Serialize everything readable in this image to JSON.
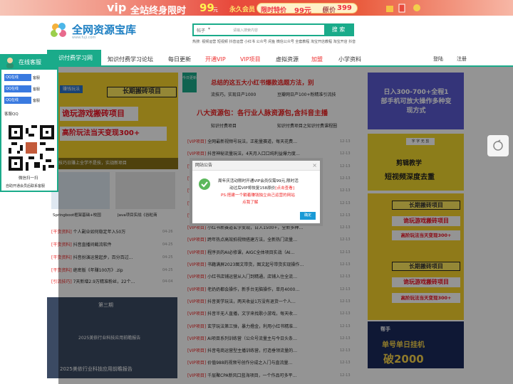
{
  "banner": {
    "vip": "vip",
    "text": "全站终身限时",
    "price_big": "99",
    "yuan": "元",
    "perm": "永久会员",
    "limited": "限时特价",
    "price": "99元",
    "orig_label": "原价",
    "orig": "399"
  },
  "header": {
    "logo_title": "全网资源宝库",
    "logo_sub": "www.fuji.com",
    "search_select": "帖子",
    "search_placeholder": "请输入搜索内容",
    "search_button": "搜 索",
    "hot": "热搜: 视频运营 短视频 抖音运营 小红书 公众号 闲鱼 微信公众号 全套教程 淘宝开店教程 淘宝开店 抖音"
  },
  "nav": {
    "items": [
      "知识付费学习网",
      "知识付费学习论坛",
      "每日更新",
      "开通VIP",
      "VIP项目",
      "虚拟资源",
      "加盟",
      "小学资料"
    ],
    "login": "登陆",
    "register": "注册"
  },
  "float_panel": {
    "title": "在线客服",
    "qq_label": "QQ在线",
    "kefu": "客服",
    "kefu_qq": "客服QQ",
    "wechat": "微信扫一扫",
    "note": "自助开通会员后联系客服"
  },
  "left_col": {
    "slide_tag": "赚钱玩法",
    "slide_title1": "长期搬砖项目",
    "slide_title2": "诡玩游戏搬砖项目",
    "slide_title3": "高阶玩法当天变现300+",
    "slide_caption": "小技巧日赚上全学不是技，实战新项目",
    "thumbs": [
      "Springboot框架基础+校园",
      "Java项目实战《谷粒商"
    ],
    "list": [
      {
        "tag": "[干货资料]",
        "text": "个人副业如何稳定年入50万",
        "date": "04-26"
      },
      {
        "tag": "[干货资料]",
        "text": "抖音直播间截流软件",
        "date": "04-25"
      },
      {
        "tag": "[干货资料]",
        "text": "抖音扮演运营起步，百分百过…",
        "date": "04-25"
      },
      {
        "tag": "[干货资料]",
        "text": "绝密版《年赚100万》.zip",
        "date": "04-25"
      },
      {
        "tag": "[引流技巧]",
        "text": "7天新增2.9万精准粉丝，22个…",
        "date": "04-04"
      }
    ],
    "period": "第三期",
    "report": "2025美依行业科技应用前瞻报告"
  },
  "mid_col": {
    "badge": "今日更新",
    "headline": "总结的这五大小红书爆款选题方法，别",
    "row1": "流技巧，实现日产1000",
    "row1b": "豆瓣网日产100+粉精准引流技",
    "big": "八大资源包：各行业人脉资源包,含抖音主播",
    "tabs": [
      "知识付费项目",
      "知识付费项目之知识付费课程圈"
    ],
    "list": [
      {
        "text": "全网最新视频号玩法，正能量赛道，每天花费…",
        "date": "12-13"
      },
      {
        "text": "抖音神秘流量玩法，4天月入口口纯利益爆力度…",
        "date": "12-13"
      },
      {
        "text": "小红书粉丝爆流变现，零成本获客",
        "date": "12-13"
      },
      {
        "text": "抖音小程序项目拆解",
        "date": "12-13"
      },
      {
        "text": "知识付费全攻略",
        "date": "12-13"
      },
      {
        "text": "公众号流量主玩法",
        "date": "12-13"
      },
      {
        "text": "短视频带货运营手册",
        "date": "12-13"
      },
      {
        "text": "小红书新赛道玄学变现，日入1500+，全新多种…",
        "date": "12-13"
      },
      {
        "text": "跨年热点高效拍视频搭建方法，全新热门流量…",
        "date": "12-13"
      },
      {
        "text": "程序员的AI必修课，AIGC全体项目实战（AI…",
        "date": "12-13"
      },
      {
        "text": "书籍满屏2023图文带货，图文起号带货实现操作…",
        "date": "12-13"
      },
      {
        "text": "小红书店铺运营从入门到精通，店铺入住全流…",
        "date": "12-13"
      },
      {
        "text": "老奶奶都会操作，新手台无脑操作，单月4000…",
        "date": "12-13"
      },
      {
        "text": "抖音美学玩法，两天收益1万没有退货一个人…",
        "date": "12-13"
      },
      {
        "text": "抖音半无人直播，文字来找歌小游戏，每天收…",
        "date": "12-13"
      },
      {
        "text": "玄学玩法第三弹，暴力撸金，利用小红书精准…",
        "date": "12-13"
      },
      {
        "text": "AI项目系列训练营（公众号流量主与今日头条…",
        "date": "12-13"
      },
      {
        "text": "抖音电商运营型主播训练营，打造垂领流量的…",
        "date": "12-13"
      },
      {
        "text": "价值988的视频号创作分成之入门与直流量…",
        "date": "12-13"
      },
      {
        "text": "千层聚CPA新风口蓝海项目，一个作品可多平…",
        "date": "12-13"
      }
    ]
  },
  "right_col": {
    "ad1": "日入300-700+全程1部手机可放大操作多种变现方式",
    "ad2_tag": "剪辑教学",
    "ad2": "短视频深度去重",
    "ad3a": "长期搬砖项目",
    "ad3b": "诡玩游戏搬砖项目",
    "ad3c": "高阶玩法当天变现300+",
    "ad4a": "长期搬砖项目",
    "ad4b": "诡玩游戏搬砖项目",
    "ad4c": "高阶玩法当天变现300+",
    "ad5a": "帮手",
    "ad5b": "单号单日挂机",
    "ad5c": "破2000"
  },
  "modal": {
    "title": "网站公告",
    "close": "×",
    "line1": "周年庆活动限时开通VIP会员仅需99元,限时活",
    "line2": "动过后VIP将恢复158原价",
    "line2_link": "点击查看",
    "line3": "PS:搭建一个躺着赚钱独立自己运营的网站",
    "line4": "点我了解",
    "ok": "确定"
  },
  "colors": {
    "accent": "#1aab8a",
    "red": "#e22222",
    "link": "#e22222"
  }
}
